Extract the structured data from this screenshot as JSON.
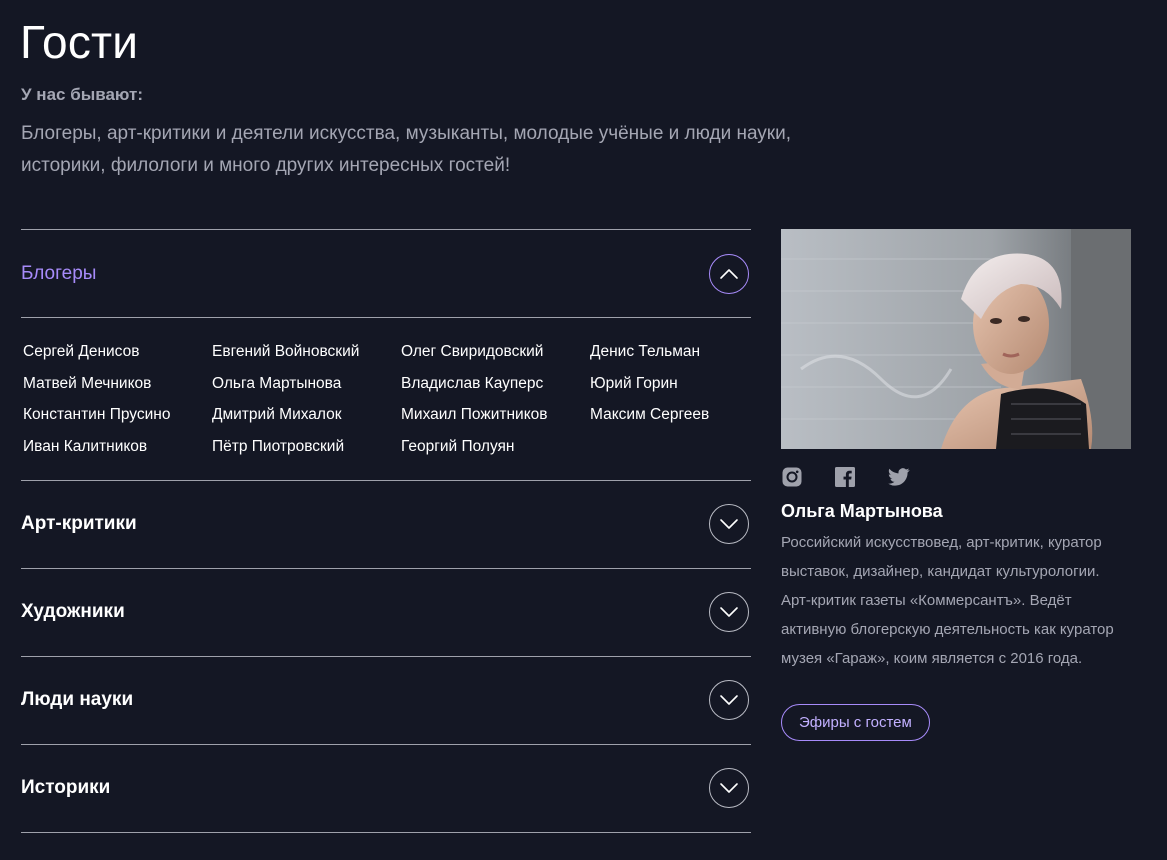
{
  "page": {
    "title": "Гости",
    "intro_label": "У нас бывают:",
    "intro_text": "Блогеры, арт-критики и деятели искусства, музыканты, молодые учёные и люди науки, историки, филологи и много других интересных гостей!"
  },
  "colors": {
    "background": "#141724",
    "accent": "#a78bfa",
    "muted_text": "#a4a6b3"
  },
  "categories": [
    {
      "label": "Блогеры",
      "expanded": true,
      "toggle_icon": "chevron-up-icon",
      "people": [
        "Сергей Денисов",
        "Евгений Войновский",
        "Олег Свиридовский",
        "Денис Тельман",
        "Матвей Мечников",
        "Ольга Мартынова",
        "Владислав Кауперс",
        "Юрий Горин",
        "Константин Прусино",
        "Дмитрий Михалок",
        "Михаил Пожитников",
        "Максим Сергеев",
        "Иван Калитников",
        "Пётр Пиотровский",
        "Георгий Полуян"
      ]
    },
    {
      "label": "Арт-критики",
      "expanded": false,
      "toggle_icon": "chevron-down-icon"
    },
    {
      "label": "Художники",
      "expanded": false,
      "toggle_icon": "chevron-down-icon"
    },
    {
      "label": "Люди науки",
      "expanded": false,
      "toggle_icon": "chevron-down-icon"
    },
    {
      "label": "Историки",
      "expanded": false,
      "toggle_icon": "chevron-down-icon"
    }
  ],
  "guest": {
    "photo": "portrait-photo",
    "socials": [
      "instagram-icon",
      "facebook-icon",
      "twitter-icon"
    ],
    "name": "Ольга Мартынова",
    "bio": "Российский искусствовед, арт-критик, куратор выставок, дизайнер, кандидат культурологии. Арт-критик газеты «Коммерсантъ». Ведёт активную блогерскую деятельность как куратор музея «Гараж», коим является с 2016 года.",
    "button_label": "Эфиры с гостем"
  }
}
